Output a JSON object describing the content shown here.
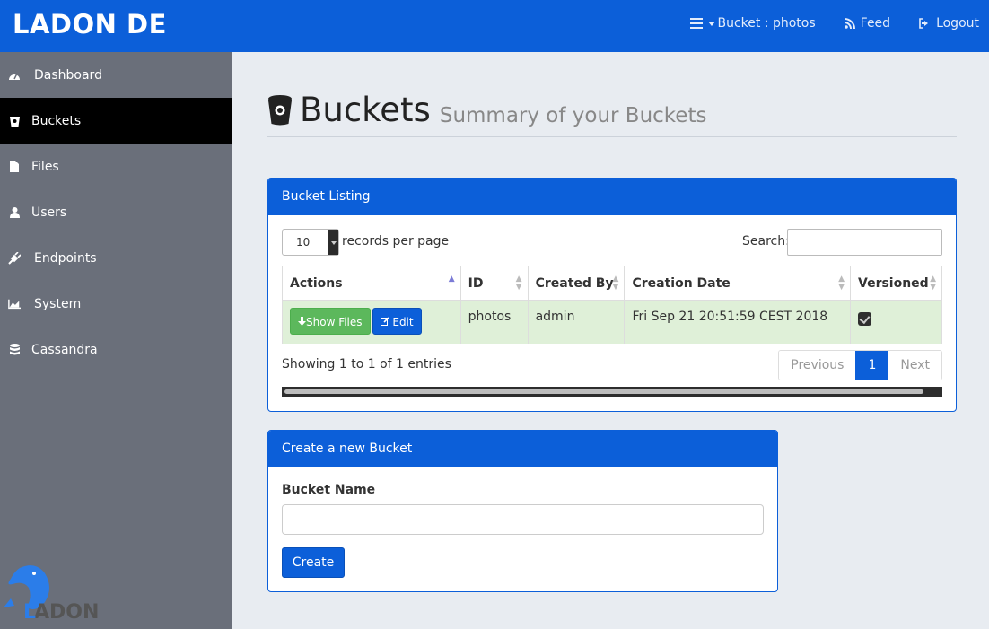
{
  "app": {
    "brand": "LADON DE"
  },
  "topnav": {
    "bucket_label": "Bucket : photos",
    "feed_label": "Feed",
    "logout_label": "Logout"
  },
  "sidebar": {
    "items": [
      {
        "label": "Dashboard",
        "icon": "dashboard-icon"
      },
      {
        "label": "Buckets",
        "icon": "bucket-icon",
        "active": true
      },
      {
        "label": "Files",
        "icon": "file-icon"
      },
      {
        "label": "Users",
        "icon": "user-icon"
      },
      {
        "label": "Endpoints",
        "icon": "plug-icon"
      },
      {
        "label": "System",
        "icon": "area-chart-icon"
      },
      {
        "label": "Cassandra",
        "icon": "database-icon"
      }
    ],
    "logo_text": "LADON"
  },
  "page": {
    "title": "Buckets",
    "subtitle": "Summary of your Buckets"
  },
  "listing": {
    "panel_title": "Bucket Listing",
    "page_length": "10",
    "length_label": "records per page",
    "search_label": "Search:",
    "search_value": "",
    "columns": [
      "Actions",
      "ID",
      "Created By",
      "Creation Date",
      "Versioned"
    ],
    "rows": [
      {
        "show_files_label": "Show Files",
        "edit_label": "Edit",
        "id": "photos",
        "created_by": "admin",
        "creation_date": "Fri Sep 21 20:51:59 CEST 2018",
        "versioned": true
      }
    ],
    "info": "Showing 1 to 1 of 1 entries",
    "pager": {
      "previous": "Previous",
      "current": "1",
      "next": "Next"
    }
  },
  "create": {
    "panel_title": "Create a new Bucket",
    "field_label": "Bucket Name",
    "field_value": "",
    "button_label": "Create"
  },
  "colors": {
    "primary": "#0c5fd9",
    "sidebar": "#6a6f7a",
    "success_row": "#dff0d8",
    "success_button": "#5cb85c"
  }
}
